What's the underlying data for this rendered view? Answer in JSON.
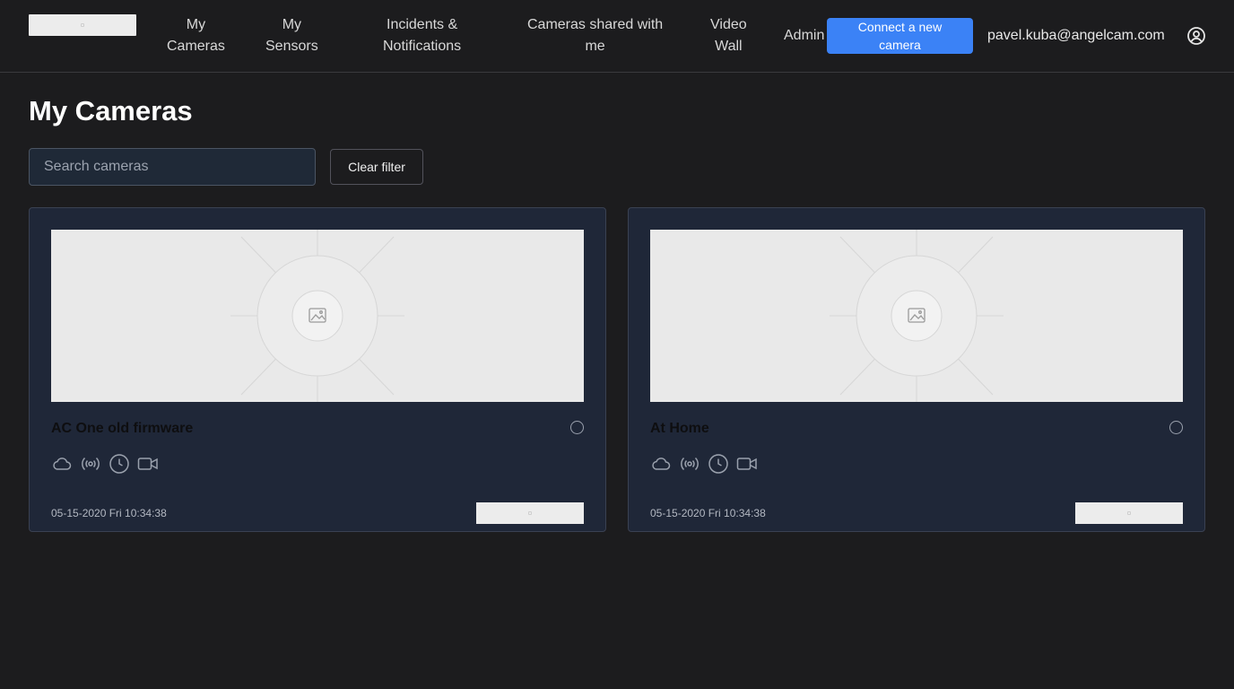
{
  "header": {
    "logo": "logo",
    "nav": [
      {
        "line1": "My",
        "line2": "Cameras"
      },
      {
        "line1": "My",
        "line2": "Sensors"
      },
      {
        "line1": "Incidents &",
        "line2": "Notifications"
      },
      {
        "line1": "Cameras shared with",
        "line2": "me"
      },
      {
        "line1": "Video",
        "line2": "Wall"
      },
      {
        "line1": "Admin",
        "line2": ""
      }
    ],
    "connect_button": {
      "line1": "Connect a new",
      "line2": "camera"
    },
    "user_email": "pavel.kuba@angelcam.com",
    "user_icon": "user-circle-icon",
    "accent_color": "#3b82f6"
  },
  "main": {
    "title": "My Cameras",
    "search": {
      "placeholder": "Search cameras",
      "value": ""
    },
    "clear_filter_label": "Clear filter"
  },
  "cameras": [
    {
      "name": "AC One old firmware",
      "timestamp": "05-15-2020 Fri 10:34:38",
      "icons": [
        "cloud-icon",
        "broadcast-icon",
        "clock-icon",
        "video-camera-icon"
      ]
    },
    {
      "name": "At Home",
      "timestamp": "05-15-2020 Fri 10:34:38",
      "icons": [
        "cloud-icon",
        "broadcast-icon",
        "clock-icon",
        "video-camera-icon"
      ]
    }
  ]
}
